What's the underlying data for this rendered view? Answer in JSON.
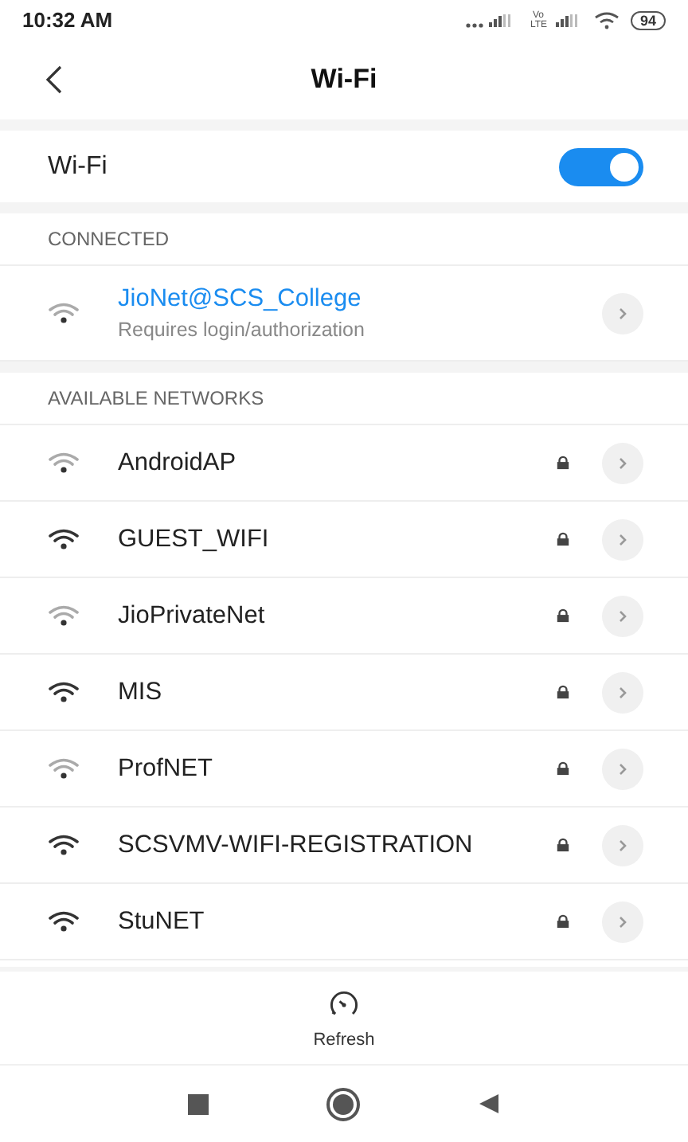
{
  "status_bar": {
    "time": "10:32 AM",
    "network": "Vo LTE",
    "battery": "94"
  },
  "header": {
    "title": "Wi-Fi"
  },
  "wifi_toggle": {
    "label": "Wi-Fi",
    "on": true
  },
  "connected": {
    "heading": "CONNECTED",
    "network": {
      "name": "JioNet@SCS_College",
      "status": "Requires login/authorization",
      "weak_signal": true
    }
  },
  "available": {
    "heading": "AVAILABLE NETWORKS",
    "networks": [
      {
        "name": "AndroidAP",
        "weak_signal": true,
        "locked": true
      },
      {
        "name": "GUEST_WIFI",
        "weak_signal": false,
        "locked": true
      },
      {
        "name": "JioPrivateNet",
        "weak_signal": true,
        "locked": true
      },
      {
        "name": "MIS",
        "weak_signal": false,
        "locked": true
      },
      {
        "name": "ProfNET",
        "weak_signal": true,
        "locked": true
      },
      {
        "name": "SCSVMV-WIFI-REGISTRATION",
        "weak_signal": false,
        "locked": true
      },
      {
        "name": "StuNET",
        "weak_signal": false,
        "locked": true
      }
    ]
  },
  "refresh": {
    "label": "Refresh"
  }
}
